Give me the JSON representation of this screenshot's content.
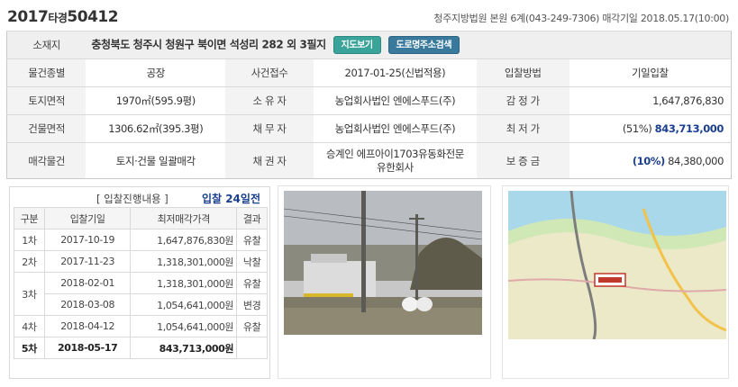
{
  "header": {
    "case_year": "2017",
    "case_type": "타경",
    "case_number": "50412",
    "court_info": "청주지방법원 본원 6계(043-249-7306) 매각기일 2018.05.17(10:00)"
  },
  "location": {
    "label": "소재지",
    "address": "충청북도 청주시 청원구 북이면 석성리 282 외 3필지",
    "map_button": "지도보기",
    "road_button": "도로명주소검색"
  },
  "rows": {
    "r1": {
      "c1": "물건종별",
      "c2": "공장",
      "c3": "사건접수",
      "c4": "2017-01-25(신법적용)",
      "c5": "입찰방법",
      "c6": "기일입찰"
    },
    "r2": {
      "c1": "토지면적",
      "c2": "1970㎡(595.9평)",
      "c3": "소 유 자",
      "c4": "농업회사법인 엔에스푸드(주)",
      "c5": "감 정 가",
      "c6": "1,647,876,830"
    },
    "r3": {
      "c1": "건물면적",
      "c2": "1306.62㎡(395.3평)",
      "c3": "채 무 자",
      "c4": "농업회사법인 엔에스푸드(주)",
      "c5": "최 저 가",
      "c6_pct": "(51%)",
      "c6": "843,713,000"
    },
    "r4": {
      "c1": "매각물건",
      "c2": "토지·건물 일괄매각",
      "c3": "채 권 자",
      "c4_l1": "승계인 에프아이1703유동화전문",
      "c4_l2": "유한회사",
      "c5": "보 증 금",
      "c6_pct": "(10%)",
      "c6": "84,380,000"
    }
  },
  "bid_progress": {
    "title": "[ 입찰진행내용 ]",
    "days": "입찰 24일전",
    "headers": [
      "구분",
      "입찰기일",
      "최저매각가격",
      "결과"
    ],
    "rows": [
      {
        "round": "1차",
        "date": "2017-10-19",
        "price": "1,647,876,830원",
        "result": "유찰"
      },
      {
        "round": "2차",
        "date": "2017-11-23",
        "price": "1,318,301,000원",
        "result": "낙찰"
      },
      {
        "round": "3차",
        "date": "2018-02-01",
        "price": "1,318,301,000원",
        "result": "유찰"
      },
      {
        "round": "",
        "date": "2018-03-08",
        "price": "1,054,641,000원",
        "result": "변경"
      },
      {
        "round": "4차",
        "date": "2018-04-12",
        "price": "1,054,641,000원",
        "result": "유찰"
      },
      {
        "round": "5차",
        "date": "2018-05-17",
        "price": "843,713,000원",
        "result": ""
      }
    ]
  },
  "colors": {
    "accent_blue": "#1a3f8f",
    "map_button": "#3aa39a",
    "road_button": "#39799c"
  }
}
